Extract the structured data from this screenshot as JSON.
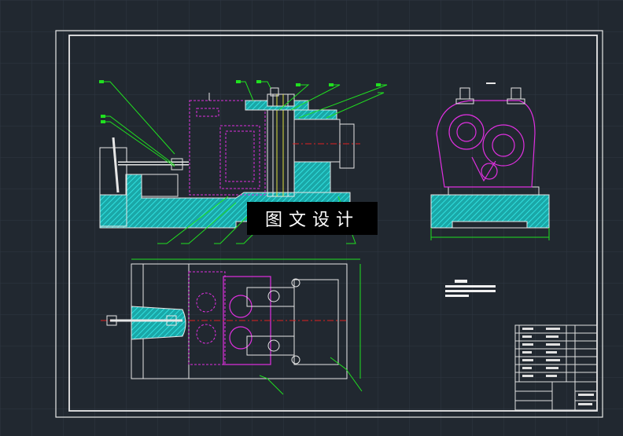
{
  "watermark": {
    "text": "图文设计"
  },
  "colors": {
    "background": "#212830",
    "grid": "#2e3742",
    "frame": "#e8e8e8",
    "part_outline": "#e6e6e6",
    "section_hatch": "#20c0c0",
    "hidden_part": "#e030e0",
    "leader": "#20e020",
    "centerline": "#e02020",
    "title_block": "#e0e0e0"
  },
  "icons": {
    "front_view": "gear-pump-fixture-front-section",
    "side_view": "gear-pump-fixture-side-view",
    "top_view": "gear-pump-fixture-top-view"
  }
}
